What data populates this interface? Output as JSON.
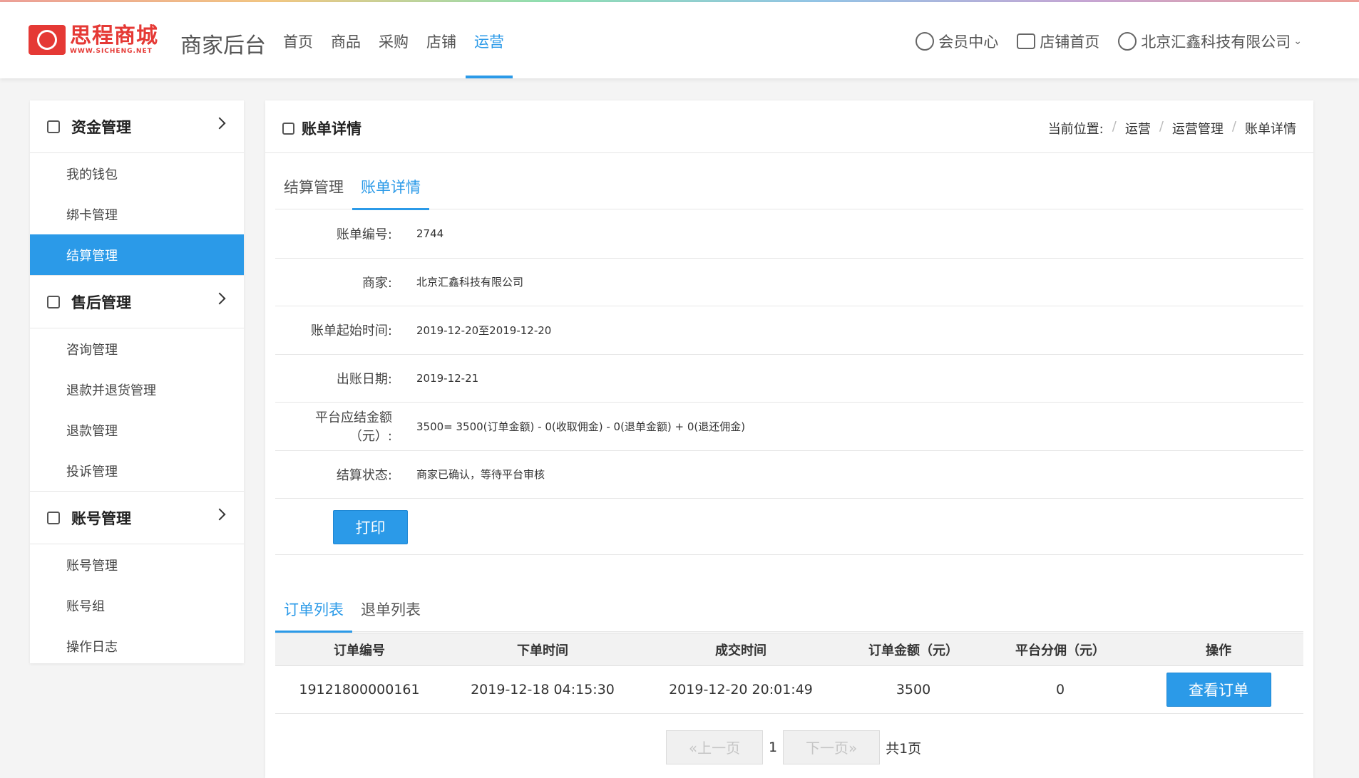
{
  "header": {
    "logo_text": "思程商城",
    "logo_sub": "WWW.SICHENG.NET",
    "brand_title": "商家后台",
    "nav": [
      {
        "label": "首页",
        "active": false
      },
      {
        "label": "商品",
        "active": false
      },
      {
        "label": "采购",
        "active": false
      },
      {
        "label": "店铺",
        "active": false
      },
      {
        "label": "运营",
        "active": true
      }
    ],
    "member_center": "会员中心",
    "store_home": "店铺首页",
    "company": "北京汇鑫科技有限公司",
    "accent_color": "#2b9ae8",
    "brand_color": "#e53935"
  },
  "sidebar": {
    "groups": [
      {
        "title": "资金管理",
        "items": [
          "我的钱包",
          "绑卡管理",
          "结算管理"
        ]
      },
      {
        "title": "售后管理",
        "items": [
          "咨询管理",
          "退款并退货管理",
          "退款管理",
          "投诉管理"
        ]
      },
      {
        "title": "账号管理",
        "items": [
          "账号管理",
          "账号组",
          "操作日志"
        ]
      }
    ],
    "active_item": "结算管理"
  },
  "panel": {
    "title": "账单详情",
    "breadcrumb": {
      "prefix": "当前位置:",
      "items": [
        "运营",
        "运营管理",
        "账单详情"
      ]
    },
    "tabs": [
      {
        "label": "结算管理",
        "active": false
      },
      {
        "label": "账单详情",
        "active": true
      }
    ],
    "details": [
      {
        "label": "账单编号:",
        "value": "2744"
      },
      {
        "label": "商家:",
        "value": "北京汇鑫科技有限公司"
      },
      {
        "label": "账单起始时间:",
        "value": "2019-12-20至2019-12-20"
      },
      {
        "label": "出账日期:",
        "value": "2019-12-21"
      },
      {
        "label": "平台应结金额（元）:",
        "value": "3500= 3500(订单金额) - 0(收取佣金) - 0(退单金额) + 0(退还佣金)"
      },
      {
        "label": "结算状态:",
        "value": "商家已确认，等待平台审核"
      }
    ],
    "print_label": "打印",
    "list_tabs": [
      {
        "label": "订单列表",
        "active": true
      },
      {
        "label": "退单列表",
        "active": false
      }
    ],
    "table": {
      "headers": [
        "订单编号",
        "下单时间",
        "成交时间",
        "订单金额（元）",
        "平台分佣（元）",
        "操作"
      ],
      "rows": [
        {
          "order_no": "19121800000161",
          "order_time": "2019-12-18 04:15:30",
          "deal_time": "2019-12-20 20:01:49",
          "amount": "3500",
          "commission": "0",
          "action": "查看订单"
        }
      ]
    },
    "pager": {
      "prev": "«上一页",
      "page": "1",
      "next": "下一页»",
      "total": "共1页"
    }
  }
}
